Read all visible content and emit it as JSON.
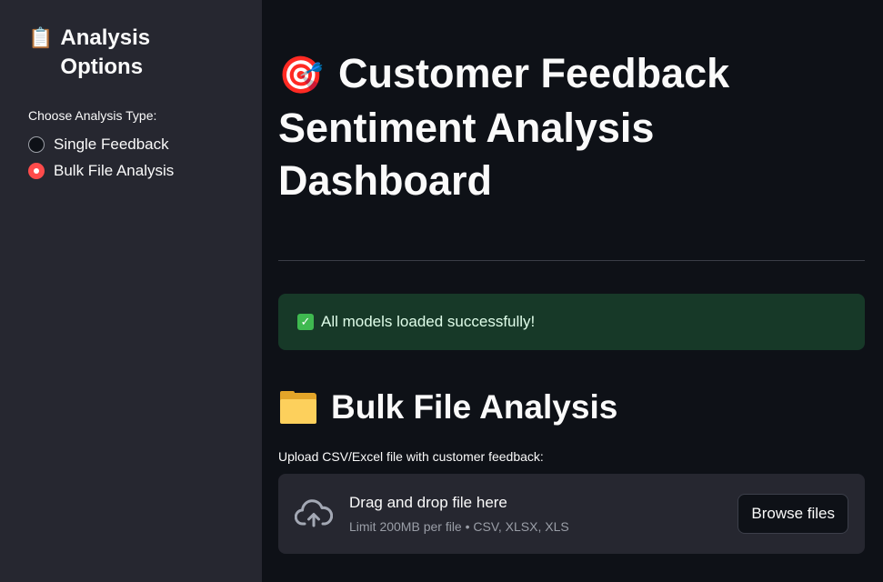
{
  "sidebar": {
    "title_icon": "clipboard-icon",
    "title_emoji": "📋",
    "title": "Analysis Options",
    "radio_label": "Choose Analysis Type:",
    "options": [
      {
        "label": "Single Feedback",
        "selected": false
      },
      {
        "label": "Bulk File Analysis",
        "selected": true
      }
    ]
  },
  "main": {
    "title_icon": "target-icon",
    "title_emoji": "🎯",
    "title": "Customer Feedback Sentiment Analysis Dashboard",
    "alert": {
      "icon": "check-icon",
      "text": "All models loaded successfully!"
    },
    "section": {
      "icon": "folder-icon",
      "title": "Bulk File Analysis"
    },
    "uploader": {
      "label": "Upload CSV/Excel file with customer feedback:",
      "drop_text": "Drag and drop file here",
      "limit_text": "Limit 200MB per file • CSV, XLSX, XLS",
      "button_label": "Browse files"
    }
  },
  "colors": {
    "background": "#0e1117",
    "sidebar": "#262730",
    "accent": "#ff4b4b",
    "success_bg": "#173928"
  }
}
